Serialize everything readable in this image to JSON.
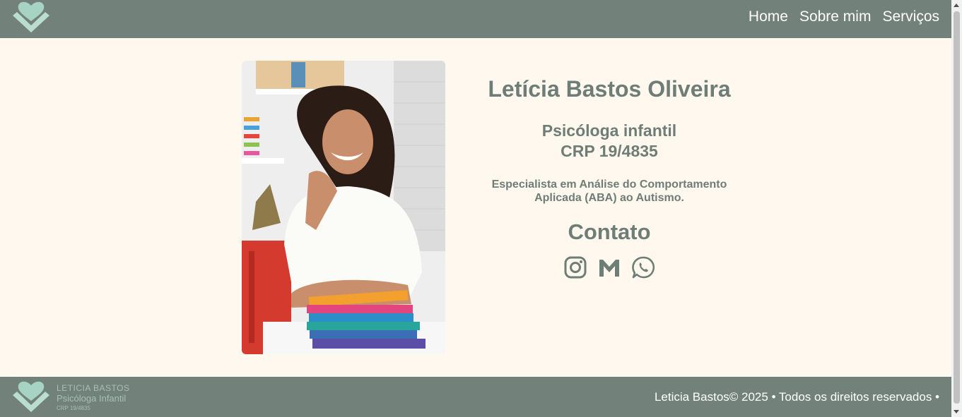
{
  "nav": {
    "items": [
      {
        "label": "Home"
      },
      {
        "label": "Sobre mim"
      },
      {
        "label": "Serviços"
      }
    ]
  },
  "profile": {
    "name": "Letícia Bastos Oliveira",
    "role": "Psicóloga infantil",
    "crp": "CRP 19/4835",
    "specialty": "Especialista em Análise do Comportamento Aplicada (ABA) ao Autismo."
  },
  "contact": {
    "title": "Contato",
    "icons": [
      "instagram-icon",
      "gmail-icon",
      "whatsapp-icon"
    ]
  },
  "footer": {
    "brand_name": "LETICIA BASTOS",
    "brand_role": "Psicóloga Infantil",
    "brand_crp": "CRP 19/4835",
    "copyright": "Leticia Bastos© 2025 • Todos os direitos reservados •"
  },
  "colors": {
    "header_bg": "#72827a",
    "page_bg": "#fff8ef",
    "text_accent": "#6e7d76",
    "logo_mint": "#a6d3c4"
  }
}
